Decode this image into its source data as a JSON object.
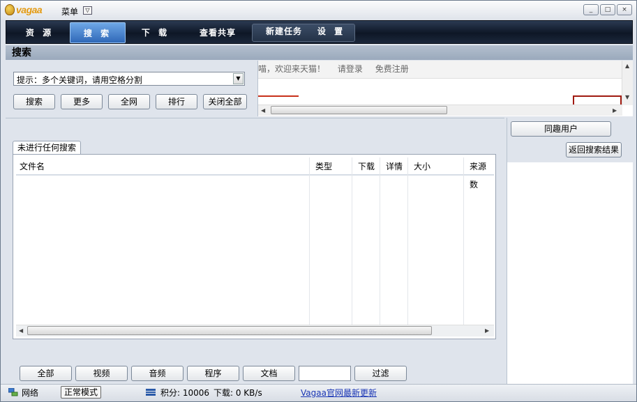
{
  "titlebar": {
    "logo": "vagaa",
    "menu_label": "菜单",
    "menu_arrow": "▽",
    "minimize": "_",
    "restore": "□",
    "close": "×"
  },
  "nav": {
    "tabs": [
      {
        "label": "资 源"
      },
      {
        "label": "搜 索",
        "active": true
      },
      {
        "label": "下 载"
      },
      {
        "label": "查看共享"
      },
      {
        "label": "新建任务"
      },
      {
        "label": "设 置"
      }
    ]
  },
  "section": {
    "title": "搜索"
  },
  "search": {
    "combo_text": "提示：多个关键词，请用空格分割",
    "buttons": [
      "搜索",
      "更多",
      "全网",
      "排行",
      "关闭全部"
    ]
  },
  "web": {
    "welcome": "喵，欢迎来天猫！",
    "login": "请登录",
    "register": "免费注册",
    "partial_text": "天猫"
  },
  "results": {
    "tab_label": "未进行任何搜索",
    "columns": [
      "文件名",
      "类型",
      "下载",
      "详情",
      "大小",
      "来源数"
    ]
  },
  "filters": {
    "buttons": [
      "全部",
      "视频",
      "音频",
      "程序",
      "文档"
    ],
    "input_value": "",
    "apply": "过滤"
  },
  "side": {
    "same_interest": "同趣用户",
    "back": "返回搜索结果"
  },
  "status": {
    "network": "网络",
    "mode": "正常模式",
    "points": "积分: 10006",
    "download": "下载: 0 KB/s",
    "update_link": "Vagaa官网最新更新"
  },
  "colors": {
    "nav_bg": "#0e1726",
    "active_tab": "#2f68b8",
    "link": "#1a36b5",
    "accent_red": "#c8301a"
  }
}
